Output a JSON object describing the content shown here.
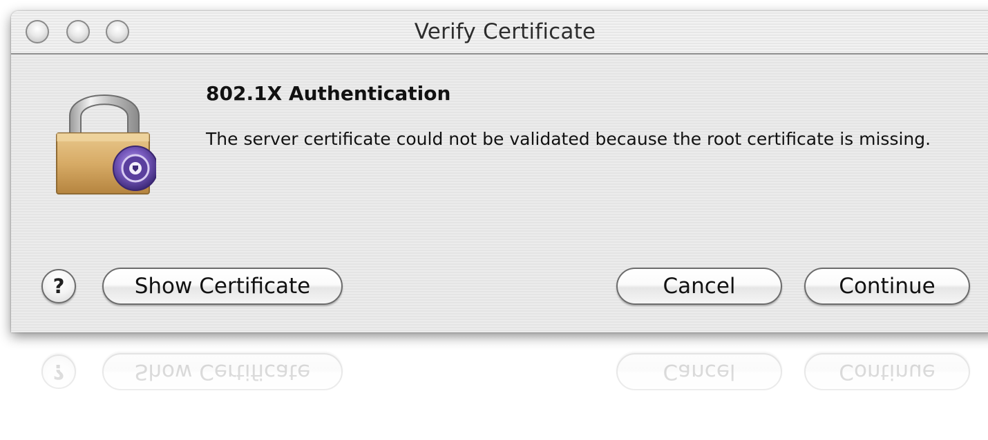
{
  "window": {
    "title": "Verify Certificate"
  },
  "dialog": {
    "heading": "802.1X Authentication",
    "message": "The server certificate could not be validated because the root certificate is missing.",
    "icon": "padlock-certificate-icon"
  },
  "buttons": {
    "help_label": "?",
    "show_certificate": "Show Certificate",
    "cancel": "Cancel",
    "continue": "Continue"
  },
  "colors": {
    "window_background": "#ececec",
    "button_border": "#6c6c6c",
    "seal": "#6a4fa3"
  }
}
